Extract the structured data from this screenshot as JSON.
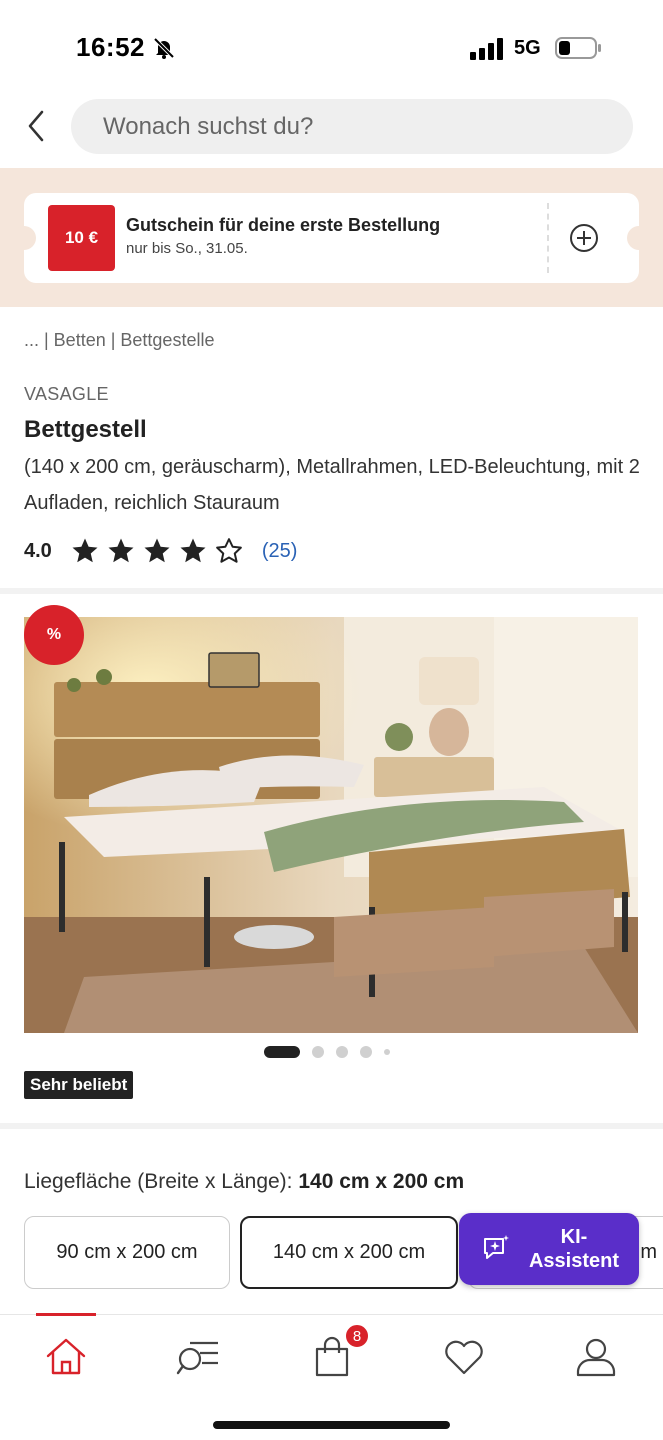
{
  "status_bar": {
    "time": "16:52",
    "network": "5G"
  },
  "search": {
    "placeholder": "Wonach suchst du?"
  },
  "coupon": {
    "amount": "10 €",
    "title": "Gutschein für deine erste Bestellung",
    "validity": "nur bis So., 31.05."
  },
  "breadcrumb": "... | Betten | Bettgestelle",
  "product": {
    "brand": "VASAGLE",
    "title": "Bettgestell",
    "description": "(140 x 200 cm, geräuscharm), Metallrahmen, LED-Beleuchtung, mit 2 Aufladen, reichlich Stauraum",
    "rating": "4.0",
    "rating_stars": 4,
    "rating_max": 5,
    "review_count": "(25)",
    "sale_badge": "%",
    "popular_badge": "Sehr beliebt",
    "gallery_active_index": 0
  },
  "size": {
    "label": "Liegefläche (Breite x Länge):",
    "selected_value": "140 cm x 200 cm",
    "options": [
      "90 cm x 200 cm",
      "140 cm x 200 cm",
      "m"
    ]
  },
  "assistant": {
    "label": "KI-Assistent"
  },
  "bottom_nav": {
    "items": [
      "home-icon",
      "search-list-icon",
      "cart-icon",
      "heart-icon",
      "user-icon"
    ],
    "cart_count": "8"
  },
  "colors": {
    "accent": "#d8222a",
    "assistant": "#5a2ec9",
    "link": "#2a62b5",
    "coupon_bg": "#f5e6db"
  }
}
